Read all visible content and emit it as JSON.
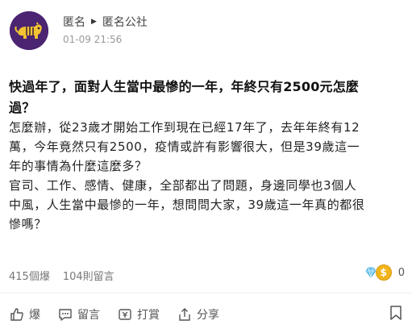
{
  "post": {
    "author": "匿名",
    "board": "匿名公社",
    "timestamp": "01-09 21:56",
    "title_line1": "快過年了，面對人生當中最慘的一年，年終只有2500元怎麼",
    "title_line2": "過？",
    "body_lines": [
      "怎麼辦，從23歲才開始工作到現在已經17年了，去年年終有12",
      "萬，今年竟然只有2500，疫情或許有影響很大，但是39歲這一",
      "年的事情為什麼這麼多？",
      "官司、工作、感情、健康，全部都出了問題，身邊同學也3個人",
      "中風，人生當中最慘的一年，想問問大家，39歲這一年真的都很",
      "慘嗎？"
    ]
  },
  "stats": {
    "likes": "415個爆",
    "comments": "104則留言"
  },
  "coins": {
    "count": "0",
    "dollar_symbol": "$"
  },
  "actions": {
    "like_label": "爆",
    "comment_label": "留言",
    "tip_label": "打賞",
    "share_label": "分享"
  },
  "icons": {
    "avatar": "tiger-avatar",
    "like": "thumbs-up-icon",
    "comment": "comment-icon",
    "tip": "tip-icon",
    "share": "share-icon",
    "bookmark": "bookmark-icon"
  },
  "colors": {
    "avatar_bg": "#4b2472",
    "coin_gold": "#f2b51b",
    "gem_blue": "#6fc6f0"
  }
}
